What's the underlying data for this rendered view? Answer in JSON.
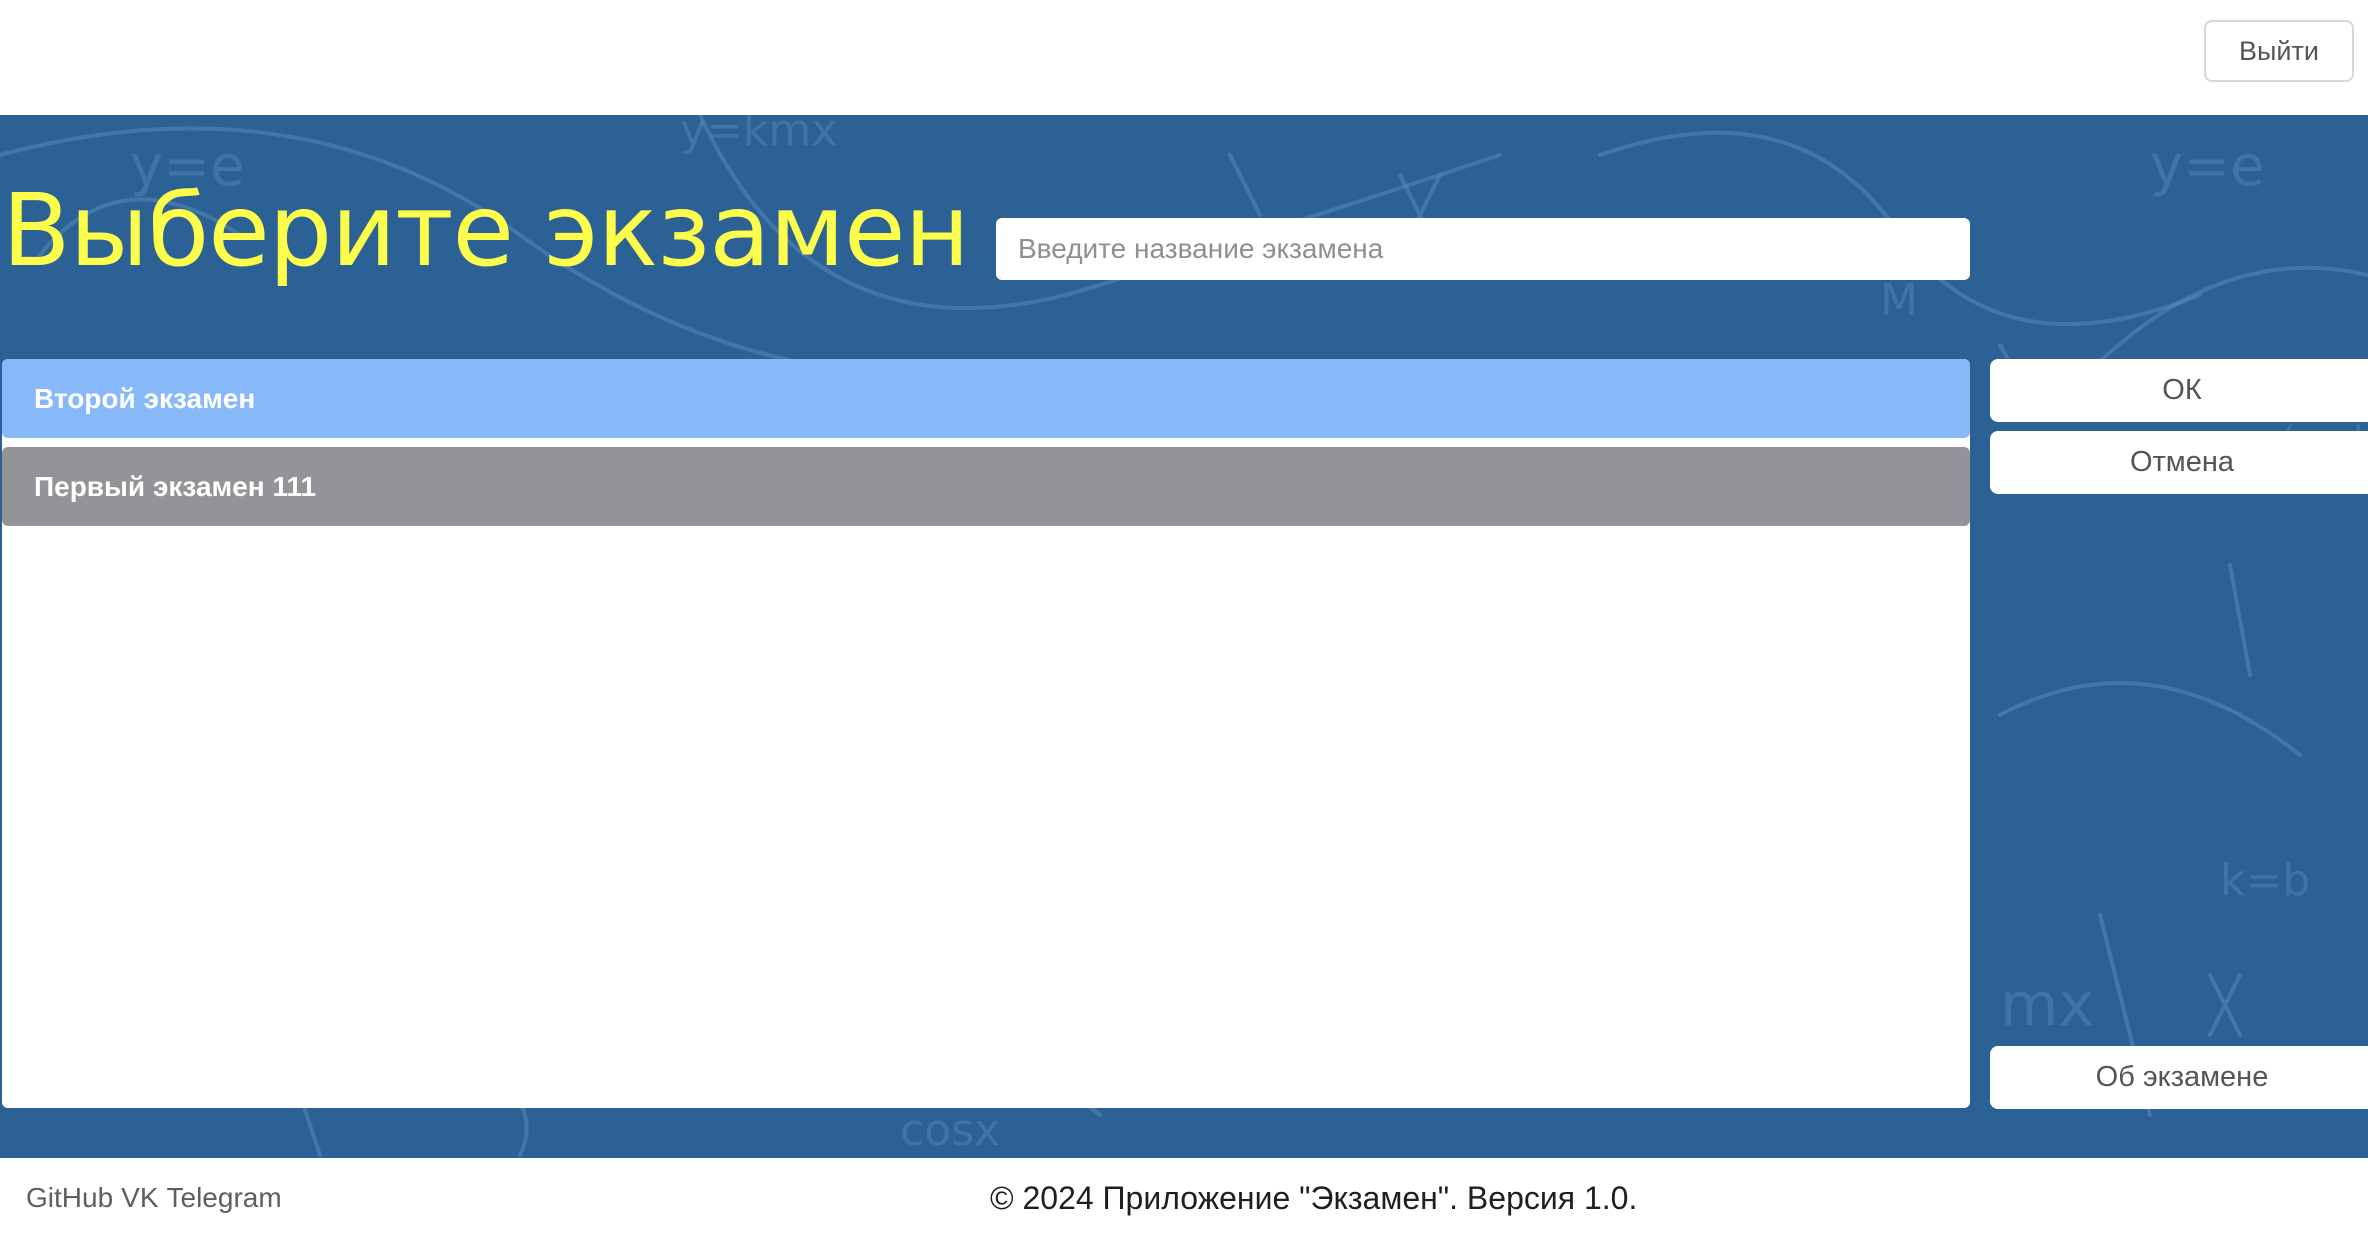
{
  "header": {
    "logout_label": "Выйти"
  },
  "main": {
    "title": "Выберите экзамен",
    "search": {
      "placeholder": "Введите название экзамена",
      "value": ""
    },
    "exams": [
      {
        "label": "Второй экзамен",
        "selected": true
      },
      {
        "label": "Первый экзамен 111",
        "selected": false
      }
    ],
    "actions": {
      "ok_label": "ОК",
      "cancel_label": "Отмена",
      "about_label": "Об экзамене"
    }
  },
  "footer": {
    "links": [
      "GitHub",
      "VK",
      "Telegram"
    ],
    "copyright": "© 2024 Приложение \"Экзамен\". Версия 1.0."
  },
  "colors": {
    "background": "#2c6196",
    "title": "#fdfd4c",
    "selected_item": "#87b9fa",
    "unselected_item": "#939398"
  }
}
